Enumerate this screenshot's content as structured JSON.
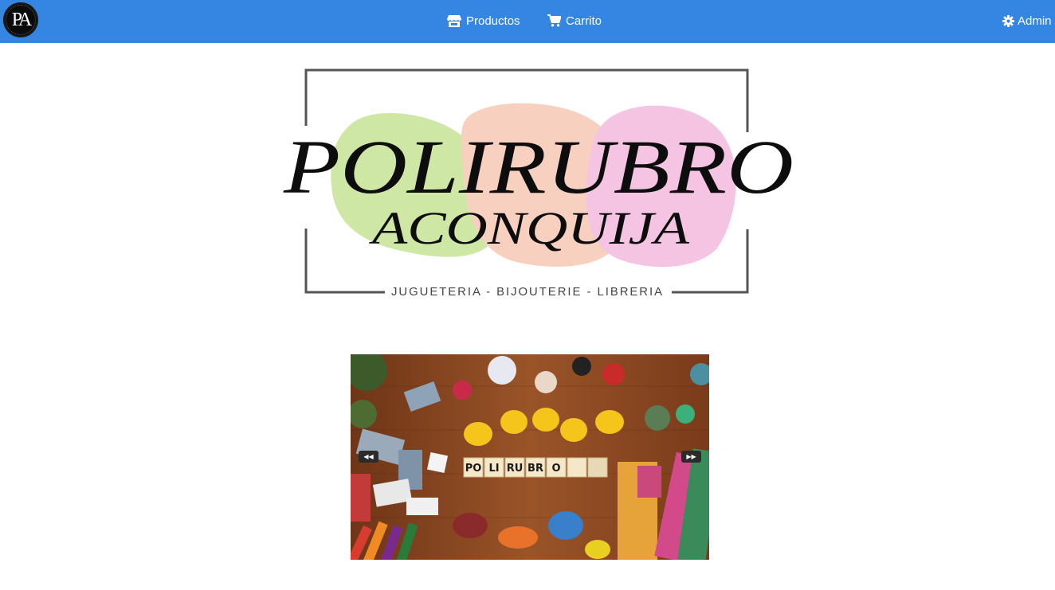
{
  "navbar": {
    "brand_initials": "PA",
    "links": [
      {
        "label": "Productos",
        "icon": "store-icon"
      },
      {
        "label": "Carrito",
        "icon": "cart-icon"
      }
    ],
    "admin": {
      "label": "Admin",
      "icon": "gear-icon"
    }
  },
  "hero": {
    "logo_line1": "POLIRUBRO",
    "logo_line2": "ACONQUIJA",
    "tagline": "JUGUETERIA - BIJOUTERIE - LIBRERIA"
  },
  "carousel": {
    "slide_tiles": [
      "PO",
      "LI",
      "RU",
      "BR",
      "O"
    ],
    "prev_icon": "rewind-icon",
    "next_icon": "fast-forward-icon"
  },
  "colors": {
    "navbar": "#3585e2",
    "blob_green": "#cfe7a4",
    "blob_peach": "#f7d0c0",
    "blob_pink": "#f6c4e3",
    "carousel_bg": "#8a4a22"
  }
}
